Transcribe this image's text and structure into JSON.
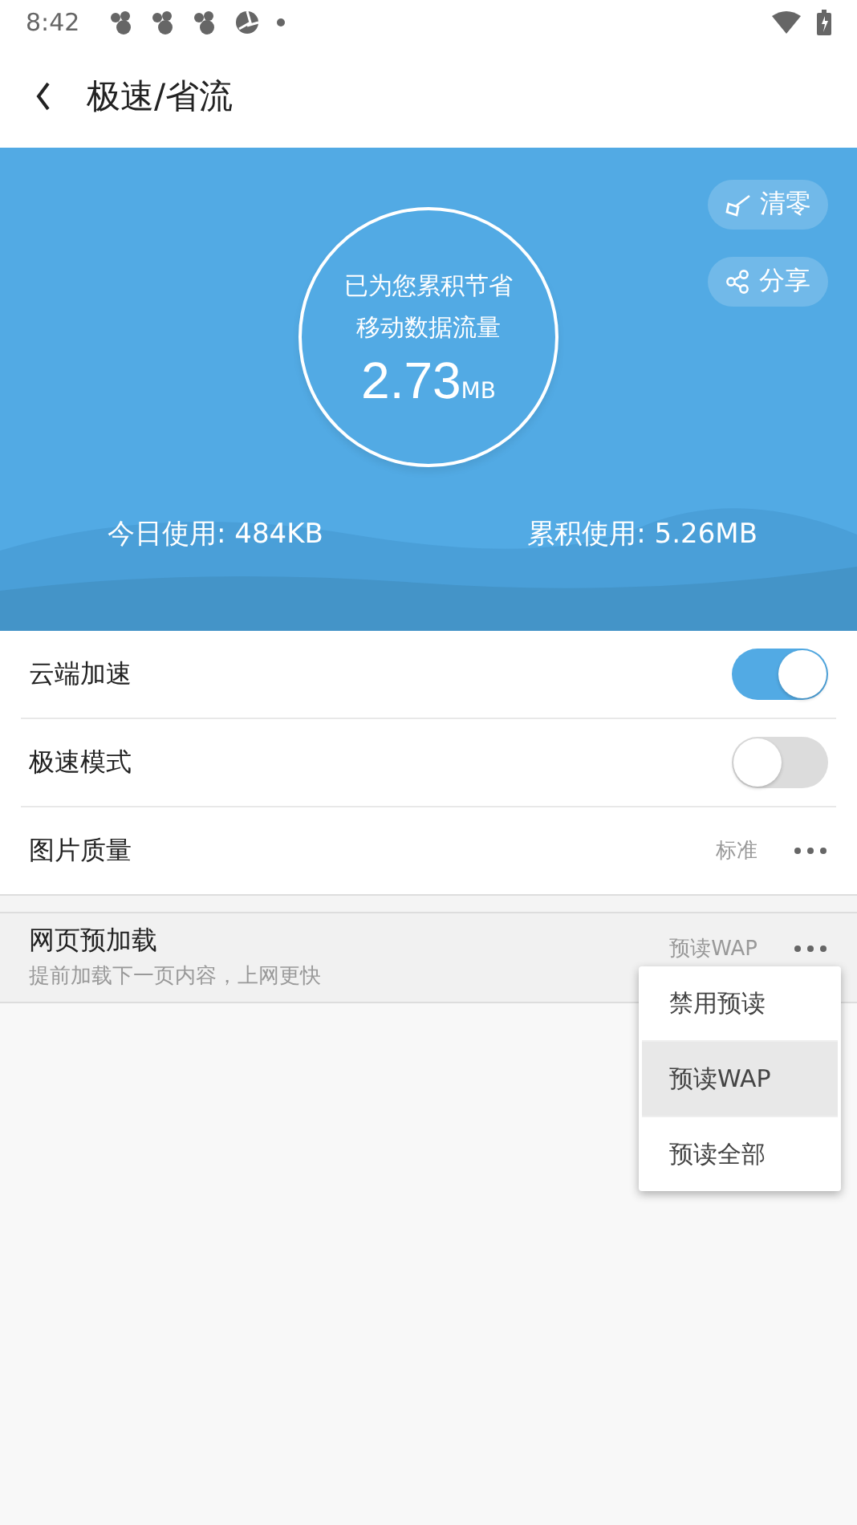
{
  "status_bar": {
    "time": "8:42"
  },
  "header": {
    "title": "极速/省流"
  },
  "hero": {
    "actions": [
      {
        "kind": "clear",
        "label": "清零"
      },
      {
        "kind": "share",
        "label": "分享"
      }
    ],
    "caption_lines": [
      "已为您累积节省",
      "移动数据流量"
    ],
    "amount": "2.73",
    "unit": "MB",
    "stats": [
      "今日使用: 484KB",
      "累积使用: 5.26MB"
    ]
  },
  "settings": [
    {
      "kind": "toggle",
      "label": "云端加速",
      "on": true
    },
    {
      "kind": "toggle",
      "label": "极速模式",
      "on": false
    },
    {
      "kind": "option",
      "label": "图片质量",
      "value": "标准"
    }
  ],
  "preload": {
    "label": "网页预加载",
    "description": "提前加载下一页内容，上网更快",
    "value": "预读WAP"
  },
  "menu": [
    {
      "label": "禁用预读",
      "selected": false
    },
    {
      "label": "预读WAP",
      "selected": true
    },
    {
      "label": "预读全部",
      "selected": false
    }
  ]
}
